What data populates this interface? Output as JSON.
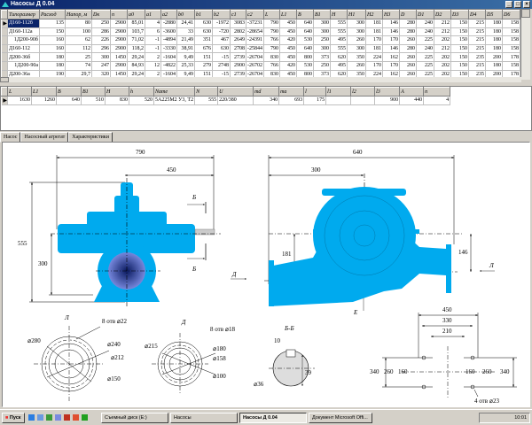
{
  "window": {
    "title": "Насосы Д 0.04"
  },
  "pumps": {
    "columns": [
      "Типоразмер",
      "Расход",
      "Напор, м",
      "Dк",
      "n",
      "a0",
      "a1",
      "a2",
      "b0",
      "b1",
      "b2",
      "c1",
      "c2",
      "L",
      "L1",
      "B",
      "B1",
      "H",
      "H1",
      "H2",
      "H3",
      "D",
      "D1",
      "D2",
      "D3",
      "D4",
      "D5",
      "D6"
    ],
    "rows": [
      [
        "Д160-112б",
        "135",
        "80",
        "250",
        "2900",
        "85,01",
        "4",
        "-2880",
        "24,41",
        "630",
        "-1972",
        "3083",
        "-37231",
        "790",
        "450",
        "640",
        "300",
        "555",
        "300",
        "181",
        "146",
        "280",
        "240",
        "212",
        "150",
        "215",
        "180",
        "158"
      ],
      [
        "Д160-112а",
        "150",
        "100",
        "286",
        "2900",
        "103,7",
        "6",
        "-3600",
        "33",
        "630",
        "-720",
        "2802",
        "-28654",
        "790",
        "450",
        "640",
        "300",
        "555",
        "300",
        "181",
        "146",
        "280",
        "240",
        "212",
        "150",
        "215",
        "180",
        "158"
      ],
      [
        "1Д200-90б",
        "160",
        "62",
        "226",
        "2900",
        "71,02",
        "-1",
        "-4894",
        "21,49",
        "351",
        "467",
        "2649",
        "-24391",
        "766",
        "420",
        "530",
        "250",
        "495",
        "260",
        "170",
        "170",
        "260",
        "225",
        "202",
        "150",
        "215",
        "180",
        "158"
      ],
      [
        "Д160-112",
        "160",
        "112",
        "296",
        "2900",
        "118,2",
        "-1",
        "-3330",
        "38,91",
        "676",
        "630",
        "2708",
        "-25844",
        "790",
        "450",
        "640",
        "300",
        "555",
        "300",
        "181",
        "146",
        "280",
        "240",
        "212",
        "150",
        "215",
        "180",
        "158"
      ],
      [
        "Д200-36б",
        "180",
        "25",
        "300",
        "1450",
        "29,24",
        "2",
        "-1604",
        "9,49",
        "151",
        "-15",
        "2739",
        "-26704",
        "830",
        "450",
        "800",
        "373",
        "620",
        "350",
        "224",
        "162",
        "260",
        "225",
        "202",
        "150",
        "235",
        "200",
        "178"
      ],
      [
        "1Д200-90а",
        "180",
        "74",
        "247",
        "2900",
        "84,93",
        "12",
        "-4822",
        "25,33",
        "279",
        "2748",
        "2900",
        "-26702",
        "766",
        "420",
        "530",
        "250",
        "495",
        "260",
        "170",
        "170",
        "260",
        "225",
        "202",
        "150",
        "215",
        "180",
        "158"
      ],
      [
        "Д200-36а",
        "190",
        "29,7",
        "320",
        "1450",
        "29,24",
        "2",
        "-1604",
        "9,49",
        "151",
        "-15",
        "2739",
        "-26704",
        "830",
        "450",
        "800",
        "373",
        "620",
        "350",
        "224",
        "162",
        "260",
        "225",
        "202",
        "150",
        "235",
        "200",
        "178"
      ]
    ]
  },
  "unit": {
    "columns": [
      "L",
      "L1",
      "B",
      "B1",
      "H",
      "h",
      "Name",
      "N",
      "U",
      "md",
      "ma",
      "l",
      "l1",
      "l2",
      "l3",
      "A",
      "n"
    ],
    "rows": [
      [
        "1630",
        "1260",
        "640",
        "510",
        "830",
        "520",
        "5А225М2 У3, Т2",
        "555",
        "220/380",
        "340",
        "693",
        "175",
        "",
        "",
        "900",
        "440",
        "4"
      ]
    ]
  },
  "tabs": [
    "Насос",
    "Насосный агрегат",
    "Характеристики"
  ],
  "drawing": {
    "front": {
      "L": "790",
      "L1": "450",
      "H": "555",
      "H1": "300",
      "cut": "Б",
      "view_d": "Д"
    },
    "side": {
      "B": "640",
      "B1": "300",
      "H2": "181",
      "H3": "146",
      "view_l": "Л",
      "view_e": "Е"
    },
    "flange_l": {
      "title": "Л",
      "holes": "8 отв ⌀22",
      "d": "⌀280",
      "d1": "⌀240",
      "d2": "⌀212",
      "d3": "⌀150"
    },
    "flange_d": {
      "title": "Д",
      "holes": "8 отв ⌀18",
      "d": "⌀215",
      "d1": "⌀180",
      "d2": "⌀158",
      "d3": "⌀100"
    },
    "section": {
      "title": "Б-Б",
      "key": "10",
      "h": "39",
      "d": "⌀36"
    },
    "base": {
      "w1": "450",
      "w2": "330",
      "w3": "210",
      "h1": "340",
      "h2": "260",
      "h3": "160",
      "holes": "4 отв ⌀23"
    }
  },
  "taskbar": {
    "start": "Пуск",
    "tasks": [
      "Съемный диск (E:)",
      "Насосы",
      "Насосы Д 0.04",
      "Документ Microsoft Offi..."
    ],
    "time": "10:01"
  },
  "colors": {
    "pump": "#00aaee",
    "title": "#0a246a"
  }
}
